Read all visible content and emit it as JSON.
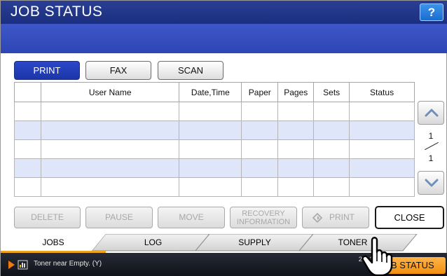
{
  "header": {
    "title": "JOB STATUS",
    "help_label": "?"
  },
  "mode_tabs": [
    {
      "label": "PRINT",
      "active": true
    },
    {
      "label": "FAX",
      "active": false
    },
    {
      "label": "SCAN",
      "active": false
    }
  ],
  "table": {
    "columns": [
      "",
      "User Name",
      "Date,Time",
      "Paper",
      "Pages",
      "Sets",
      "Status"
    ],
    "rows": [
      [],
      [],
      [],
      [],
      []
    ]
  },
  "pager": {
    "current": "1",
    "total": "1"
  },
  "actions": {
    "delete": "DELETE",
    "pause": "PAUSE",
    "move": "MOVE",
    "recovery_line1": "RECOVERY",
    "recovery_line2": "INFORMATION",
    "print": "PRINT",
    "close": "CLOSE"
  },
  "bottom_tabs": [
    {
      "label": "JOBS",
      "active": true
    },
    {
      "label": "LOG",
      "active": false
    },
    {
      "label": "SUPPLY",
      "active": false
    },
    {
      "label": "TONER",
      "active": false
    }
  ],
  "status": {
    "message": "Toner near Empty. (Y)",
    "date": "2013/05/1",
    "time": "13:3",
    "job_status_label": "B STATUS"
  },
  "colors": {
    "title_bar": "#1b2f80",
    "accent_blue": "#2e46b4",
    "row_highlight": "#dfe6fa",
    "active_tab_line": "#f0a21a",
    "job_status_button": "#f08f0e"
  },
  "icons": [
    "help-icon",
    "scroll-up-icon",
    "scroll-down-icon",
    "print-diamond-icon",
    "warning-arrow-icon",
    "toner-icon",
    "pointer-hand-icon"
  ]
}
